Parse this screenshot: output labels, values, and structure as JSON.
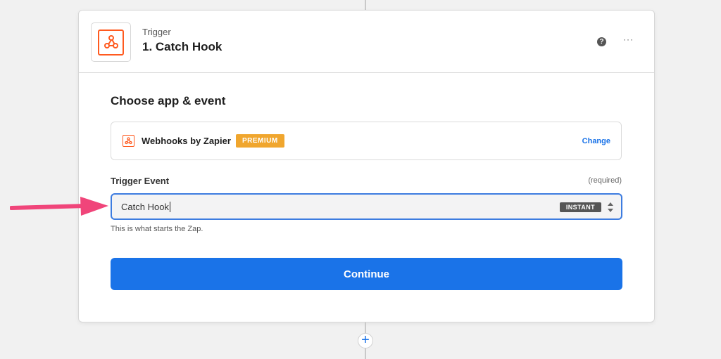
{
  "step": {
    "kind": "Trigger",
    "title": "1. Catch Hook",
    "help_icon": "?",
    "more_icon": "···"
  },
  "section": {
    "title": "Choose app & event"
  },
  "app": {
    "name": "Webhooks by Zapier",
    "badge": "PREMIUM",
    "change_label": "Change",
    "icon": "webhook-icon"
  },
  "trigger_event": {
    "label": "Trigger Event",
    "required": "(required)",
    "value": "Catch Hook",
    "badge": "INSTANT",
    "helper": "This is what starts the Zap."
  },
  "actions": {
    "continue_label": "Continue",
    "add_step_label": "+"
  },
  "colors": {
    "brand_orange": "#ff5a1f",
    "primary_blue": "#1a73e8",
    "premium_badge": "#f0a62e",
    "annotation_arrow": "#f0457a"
  }
}
